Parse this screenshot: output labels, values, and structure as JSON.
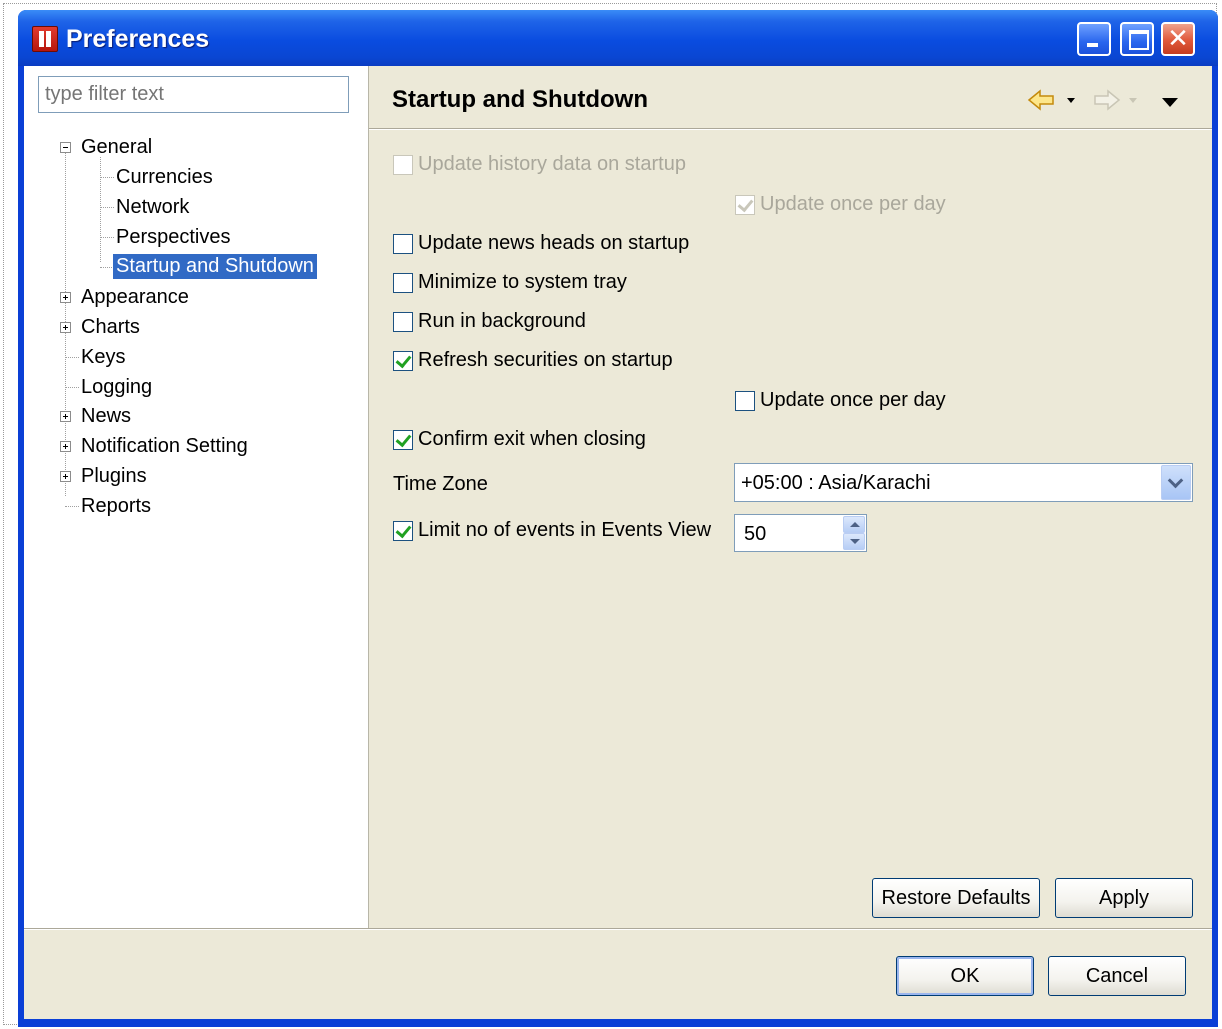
{
  "window": {
    "title": "Preferences"
  },
  "filter": {
    "placeholder": "type filter text"
  },
  "tree": {
    "general": "General",
    "currencies": "Currencies",
    "network": "Network",
    "perspectives": "Perspectives",
    "startup_shutdown": "Startup and Shutdown",
    "appearance": "Appearance",
    "charts": "Charts",
    "keys": "Keys",
    "logging": "Logging",
    "news": "News",
    "notification_setting": "Notification Setting",
    "plugins": "Plugins",
    "reports": "Reports"
  },
  "page": {
    "title": "Startup and Shutdown",
    "options": {
      "update_history": {
        "label": "Update history data on startup",
        "checked": false,
        "enabled": false
      },
      "update_history_daily": {
        "label": "Update once per day",
        "checked": true,
        "enabled": false
      },
      "update_news": {
        "label": "Update news heads on startup",
        "checked": false,
        "enabled": true
      },
      "minimize_tray": {
        "label": "Minimize to system tray",
        "checked": false,
        "enabled": true
      },
      "run_background": {
        "label": "Run in background",
        "checked": false,
        "enabled": true
      },
      "refresh_securities": {
        "label": "Refresh securities on startup",
        "checked": true,
        "enabled": true
      },
      "refresh_daily": {
        "label": "Update once per day",
        "checked": false,
        "enabled": true
      },
      "confirm_exit": {
        "label": "Confirm exit when closing",
        "checked": true,
        "enabled": true
      },
      "limit_events": {
        "label": "Limit no of events in Events View",
        "checked": true,
        "enabled": true
      }
    },
    "time_zone_label": "Time Zone",
    "time_zone_value": "+05:00 : Asia/Karachi",
    "events_limit_value": "50",
    "restore_defaults": "Restore Defaults",
    "apply": "Apply"
  },
  "footer": {
    "ok": "OK",
    "cancel": "Cancel"
  },
  "icons": {
    "app": "app-icon",
    "minimize": "minimize-icon",
    "maximize": "maximize-icon",
    "close": "close-icon",
    "back": "back-arrow-icon",
    "forward": "forward-arrow-icon",
    "view_menu": "view-menu-icon"
  },
  "colors": {
    "titlebar": "#0a4ce0",
    "selection": "#316ac5",
    "dialog_bg": "#ece9d8",
    "check": "#21a121"
  }
}
